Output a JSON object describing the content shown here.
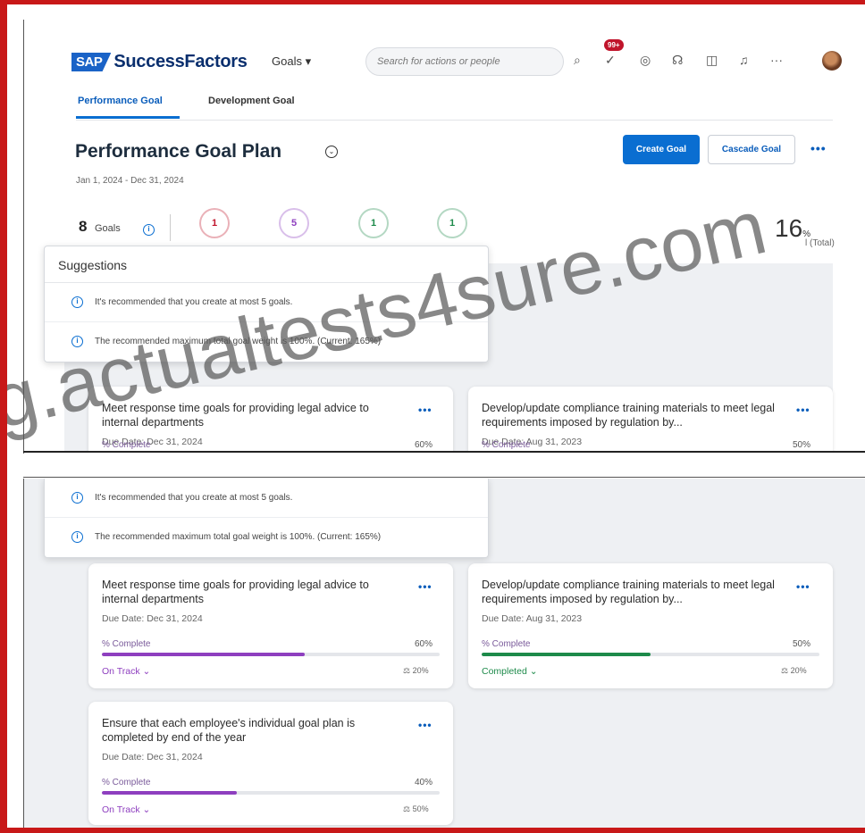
{
  "shell": {
    "logo_sap": "SAP",
    "logo_product": "SuccessFactors",
    "menu_label": "Goals ▾",
    "search_placeholder": "Search for actions or people",
    "notification_badge": "99+"
  },
  "tabs": [
    {
      "label": "Performance Goal",
      "active": true
    },
    {
      "label": "Development Goal",
      "active": false
    }
  ],
  "header": {
    "title": "Performance Goal Plan",
    "date_range": "Jan 1, 2024 - Dec 31, 2024",
    "create_label": "Create Goal",
    "cascade_label": "Cascade Goal",
    "more_label": "•••"
  },
  "summary": {
    "goal_count": "8",
    "goal_label": "Goals",
    "stats": [
      {
        "value": "1",
        "color": "#c0142b"
      },
      {
        "value": "5",
        "color": "#8e3fbf"
      },
      {
        "value": "1",
        "color": "#1d8a4a"
      },
      {
        "value": "1",
        "color": "#1d8a4a"
      }
    ],
    "weight_value": "16",
    "weight_pct": "%",
    "weight_caption": "l (Total)"
  },
  "suggestions": {
    "title": "Suggestions",
    "items": [
      "It's recommended that you create at most 5 goals.",
      "The recommended maximum total goal weight is 100%. (Current: 165%)"
    ]
  },
  "goals": [
    {
      "title": "Meet response time goals for providing legal advice to internal departments",
      "due": "Due Date: Dec 31, 2024",
      "pct_label": "% Complete",
      "pct_value": "60%",
      "progress": 0.6,
      "status": "On Track",
      "status_color": "#8e3fbf",
      "weight": "20%"
    },
    {
      "title": "Develop/update compliance training materials to meet legal requirements imposed by regulation by...",
      "due": "Due Date: Aug 31, 2023",
      "pct_label": "% Complete",
      "pct_value": "50%",
      "progress": 0.5,
      "status": "Completed",
      "status_color": "#1d8a4a",
      "weight": "20%"
    },
    {
      "title": "Ensure that each employee's individual goal plan is completed by end of the year",
      "due": "Due Date: Dec 31, 2024",
      "pct_label": "% Complete",
      "pct_value": "40%",
      "progress": 0.4,
      "status": "On Track",
      "status_color": "#8e3fbf",
      "weight": "50%"
    }
  ],
  "watermark": "g.actualtests4sure.com",
  "colors": {
    "accent": "#0a6ed1",
    "frame": "#c81818"
  }
}
